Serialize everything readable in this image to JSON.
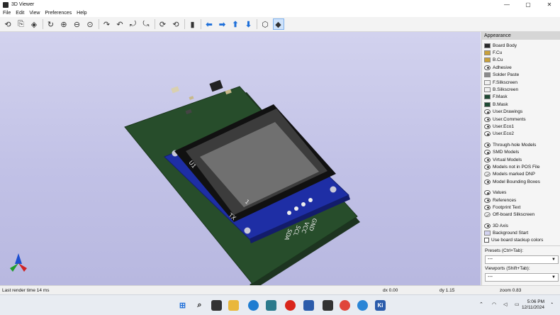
{
  "window": {
    "title": "3D Viewer",
    "controls": [
      "—",
      "▢",
      "✕"
    ]
  },
  "menu": [
    "File",
    "Edit",
    "View",
    "Preferences",
    "Help"
  ],
  "toolbar": {
    "groups": [
      [
        {
          "name": "reload-board-icon",
          "glyph": "⟲"
        },
        {
          "name": "copy-image-icon",
          "glyph": "⎘"
        },
        {
          "name": "raytrace-icon",
          "glyph": "◈"
        }
      ],
      [
        {
          "name": "redraw-icon",
          "glyph": "↻"
        },
        {
          "name": "zoom-in-icon",
          "glyph": "⊕"
        },
        {
          "name": "zoom-out-icon",
          "glyph": "⊖"
        },
        {
          "name": "zoom-fit-icon",
          "glyph": "⊙"
        }
      ],
      [
        {
          "name": "rotate-x-cw-icon",
          "glyph": "↷"
        },
        {
          "name": "rotate-x-ccw-icon",
          "glyph": "↶"
        },
        {
          "name": "rotate-y-cw-icon",
          "glyph": "⤾"
        },
        {
          "name": "rotate-y-ccw-icon",
          "glyph": "⤿"
        }
      ],
      [
        {
          "name": "rotate-z-cw-icon",
          "glyph": "⟳"
        },
        {
          "name": "rotate-z-ccw-icon",
          "glyph": "⟲"
        }
      ],
      [
        {
          "name": "flip-board-icon",
          "glyph": "▮"
        }
      ],
      [
        {
          "name": "pan-left-icon",
          "glyph": "⬅",
          "blue": true
        },
        {
          "name": "pan-right-icon",
          "glyph": "➡",
          "blue": true
        },
        {
          "name": "pan-up-icon",
          "glyph": "⬆",
          "blue": true
        },
        {
          "name": "pan-down-icon",
          "glyph": "⬇",
          "blue": true
        }
      ],
      [
        {
          "name": "ortho-toggle-icon",
          "glyph": "⬡"
        },
        {
          "name": "layers-toggle-icon",
          "glyph": "◆",
          "active": true
        }
      ]
    ]
  },
  "appearance": {
    "title": "Appearance",
    "layers": [
      {
        "label": "Board Body",
        "kind": "swatch",
        "color": "#2b2b2b"
      },
      {
        "label": "F.Cu",
        "kind": "swatch",
        "color": "#c9a13a"
      },
      {
        "label": "B.Cu",
        "kind": "swatch",
        "color": "#c9a13a"
      },
      {
        "label": "Adhesive",
        "kind": "eye"
      },
      {
        "label": "Solder Paste",
        "kind": "swatch",
        "color": "#8a8a8a"
      },
      {
        "label": "F.Silkscreen",
        "kind": "swatch",
        "color": "#f0f0f0"
      },
      {
        "label": "B.Silkscreen",
        "kind": "swatch",
        "color": "#f0f0f0"
      },
      {
        "label": "F.Mask",
        "kind": "swatch",
        "color": "#1f4a34"
      },
      {
        "label": "B.Mask",
        "kind": "swatch",
        "color": "#1f4a34"
      },
      {
        "label": "User.Drawings",
        "kind": "eye"
      },
      {
        "label": "User.Comments",
        "kind": "eye"
      },
      {
        "label": "User.Eco1",
        "kind": "eye"
      },
      {
        "label": "User.Eco2",
        "kind": "eye"
      },
      {
        "label": "Through-hole Models",
        "kind": "eye",
        "gap": true
      },
      {
        "label": "SMD Models",
        "kind": "eye"
      },
      {
        "label": "Virtual Models",
        "kind": "eye"
      },
      {
        "label": "Models not in POS File",
        "kind": "eye"
      },
      {
        "label": "Models marked DNP",
        "kind": "eye-slash"
      },
      {
        "label": "Model Bounding Boxes",
        "kind": "eye"
      },
      {
        "label": "Values",
        "kind": "eye",
        "gap": true
      },
      {
        "label": "References",
        "kind": "eye"
      },
      {
        "label": "Footprint Text",
        "kind": "eye"
      },
      {
        "label": "Off-board Silkscreen",
        "kind": "eye-slash"
      },
      {
        "label": "3D Axis",
        "kind": "eye",
        "gap": true
      },
      {
        "label": "Background Start",
        "kind": "swatch",
        "color": "#d3d3ef"
      }
    ],
    "stackup_label": "Use board stackup colors",
    "presets_label": "Presets (Ctrl+Tab):",
    "presets_value": "---",
    "viewports_label": "Viewports (Shift+Tab):",
    "viewports_value": "---"
  },
  "status": {
    "render": "Last render time 14 ms",
    "dx": "dx 0.00",
    "dy": "dy 1.15",
    "zoom": "zoom 0.83"
  },
  "scene_labels": {
    "ref": "U1",
    "pins": [
      "GND",
      "VCC",
      "SCL",
      "SDA"
    ],
    "tx": "TX",
    "pin1": "1"
  },
  "clock": {
    "time": "5:06 PM",
    "date": "12/11/2024"
  }
}
